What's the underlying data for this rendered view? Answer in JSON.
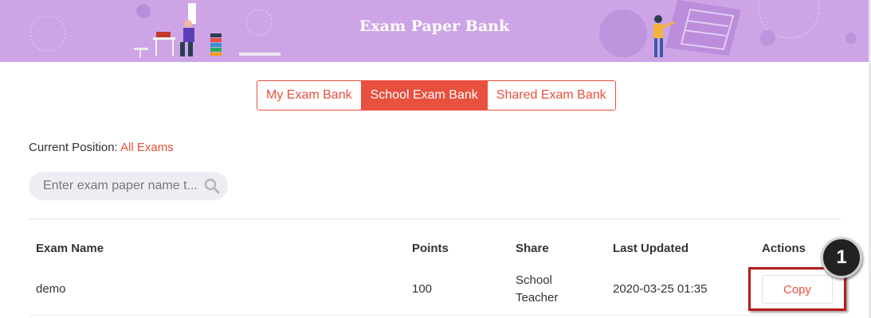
{
  "banner": {
    "title": "Exam Paper Bank"
  },
  "tabs": [
    {
      "label": "My Exam Bank",
      "active": false
    },
    {
      "label": "School Exam Bank",
      "active": true
    },
    {
      "label": "Shared Exam Bank",
      "active": false
    }
  ],
  "position": {
    "label": "Current Position:",
    "value": "All Exams"
  },
  "search": {
    "placeholder": "Enter exam paper name t..."
  },
  "table": {
    "headers": [
      "Exam Name",
      "Points",
      "Share",
      "Last Updated",
      "Actions"
    ],
    "rows": [
      {
        "name": "demo",
        "points": "100",
        "share_line1": "School",
        "share_line2": "Teacher",
        "updated": "2020-03-25 01:35",
        "action": "Copy"
      }
    ]
  },
  "annotation": {
    "number": "1"
  },
  "colors": {
    "accent": "#e8503f",
    "banner": "#cda5e7",
    "highlight": "#b51a1a"
  }
}
